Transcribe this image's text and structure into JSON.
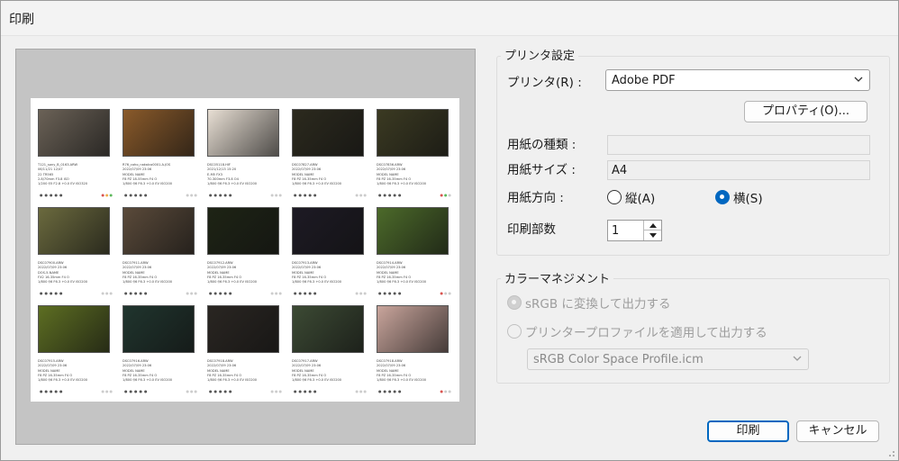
{
  "window": {
    "title": "印刷"
  },
  "preview": {
    "thumbnails": [
      {
        "color": "#6b6257",
        "lines": [
          "T121_sony_B_0163.ARW",
          "06/11/21 12/47",
          "22 TR565",
          "2.8/70mm F3.8 ISO",
          "1/200 f/5 F2.8 +0.0 EV ISO320"
        ],
        "colors": "#d9534f #f0ad4e #5cb85c"
      },
      {
        "color": "#8a5a2a",
        "lines": [
          "R76_coho_nakalco0001.A.JOS",
          "2022/07/09 23:06",
          "MODEL NAME",
          "F8 PZ 18-55mm F4 O",
          "1/800 f/6 F6.3 +0.0 EV ISO200"
        ],
        "colors": "#cccccc #cccccc #cccccc"
      },
      {
        "color": "#e8dfd4",
        "lines": [
          "DSC05118.HIF",
          "2021/12/13 15:20",
          "E-M5 FX3",
          "70-300mm F3.8 O4",
          "1/800 f/6 F6.3 +0.0 EV ISO200"
        ],
        "colors": "#cccccc #cccccc #cccccc"
      },
      {
        "color": "#2c2a1e",
        "lines": [
          "DSC07827.ARW",
          "2022/07/09 23:06",
          "MODEL NAME",
          "F8 PZ 16-35mm F4 O",
          "1/800 f/6 F6.3 +0.0 EV ISO200"
        ],
        "colors": "#cccccc #cccccc #cccccc"
      },
      {
        "color": "#3b3a22",
        "lines": [
          "DSC07836.ARW",
          "2022/07/09 23:06",
          "MODEL NAME",
          "F8 PZ 16-35mm F4 O",
          "1/800 f/6 F6.3 +0.0 EV ISO200"
        ],
        "colors": "#d9534f #5cb85c #cccccc"
      },
      {
        "color": "#6b6a3e",
        "lines": [
          "DSC07900.ARW",
          "2022/07/09 23:06",
          "DOS-5-NAME",
          "FX2 16-35mm F4 O",
          "1/800 f/6 F6.3 +0.0 EV ISO200"
        ],
        "colors": "#cccccc #cccccc #cccccc"
      },
      {
        "color": "#5a4a3a",
        "lines": [
          "DSC07911.ARW",
          "2022/07/09 23:06",
          "MODEL NAME",
          "F8 PZ 16-35mm F4 O",
          "1/800 f/6 F6.3 +0.0 EV ISO200"
        ],
        "colors": "#cccccc #cccccc #cccccc"
      },
      {
        "color": "#1e2415",
        "lines": [
          "DSC07912.ARW",
          "2022/07/09 23:06",
          "MODEL NAME",
          "F8 PZ 16-35mm F4 O",
          "1/800 f/6 F6.3 +0.0 EV ISO200"
        ],
        "colors": "#cccccc #cccccc #cccccc"
      },
      {
        "color": "#1d1a24",
        "lines": [
          "DSC07913.ARW",
          "2022/07/09 23:06",
          "MODEL NAME",
          "F8 PZ 16-35mm F4 O",
          "1/800 f/6 F6.3 +0.0 EV ISO200"
        ],
        "colors": "#cccccc #cccccc #cccccc"
      },
      {
        "color": "#4c6a2a",
        "lines": [
          "DSC07914.ARW",
          "2022/07/09 23:06",
          "MODEL NAME",
          "F8 PZ 16-35mm F4 O",
          "1/800 f/6 F6.3 +0.0 EV ISO200"
        ],
        "colors": "#d9534f #cccccc #cccccc"
      },
      {
        "color": "#5d6e22",
        "lines": [
          "DSC07915.ARW",
          "2022/07/09 23:06",
          "MODEL NAME",
          "F8 PZ 16-35mm F4 O",
          "1/800 f/6 F6.3 +0.0 EV ISO200"
        ],
        "colors": "#cccccc #cccccc #cccccc"
      },
      {
        "color": "#20352e",
        "lines": [
          "DSC07916.ARW",
          "2022/07/09 23:06",
          "MODEL NAME",
          "F8 PZ 16-35mm F4 O",
          "1/800 f/6 F6.3 +0.0 EV ISO200"
        ],
        "colors": "#cccccc #cccccc #cccccc"
      },
      {
        "color": "#2a2622",
        "lines": [
          "DSC07918.ARW",
          "2022/07/09 23:06",
          "MODEL NAME",
          "F8 PZ 16-35mm F4 O",
          "1/800 f/6 F6.3 +0.0 EV ISO200"
        ],
        "colors": "#cccccc #cccccc #cccccc"
      },
      {
        "color": "#3c4a34",
        "lines": [
          "DSC07917.ARW",
          "2022/07/09 23:06",
          "MODEL NAME",
          "F8 PZ 16-35mm F4 O",
          "1/800 f/6 F6.3 +0.0 EV ISO200"
        ],
        "colors": "#cccccc #cccccc #cccccc"
      },
      {
        "color": "#c9a59c",
        "lines": [
          "DSC07918.ARW",
          "2022/07/09 23:06",
          "MODEL NAME",
          "F8 PZ 16-35mm F4 O",
          "1/800 f/6 F6.3 +0.0 EV ISO200"
        ],
        "colors": "#d9534f #cccccc #cccccc"
      }
    ]
  },
  "printer_settings": {
    "group_title": "プリンタ設定",
    "printer_label": "プリンタ(R) :",
    "printer_value": "Adobe PDF",
    "properties_button": "プロパティ(O)...",
    "paper_type_label": "用紙の種類 :",
    "paper_type_value": "",
    "paper_size_label": "用紙サイズ :",
    "paper_size_value": "A4",
    "orientation_label": "用紙方向 :",
    "portrait_label": "縦(A)",
    "landscape_label": "横(S)",
    "copies_label": "印刷部数",
    "copies_value": "1"
  },
  "color_management": {
    "group_title": "カラーマネジメント",
    "option_srgb": "sRGB に変換して出力する",
    "option_profile": "プリンタープロファイルを適用して出力する",
    "profile_value": "sRGB Color Space Profile.icm"
  },
  "buttons": {
    "print": "印刷",
    "cancel": "キャンセル"
  },
  "colors": {
    "accent": "#0067c0"
  }
}
